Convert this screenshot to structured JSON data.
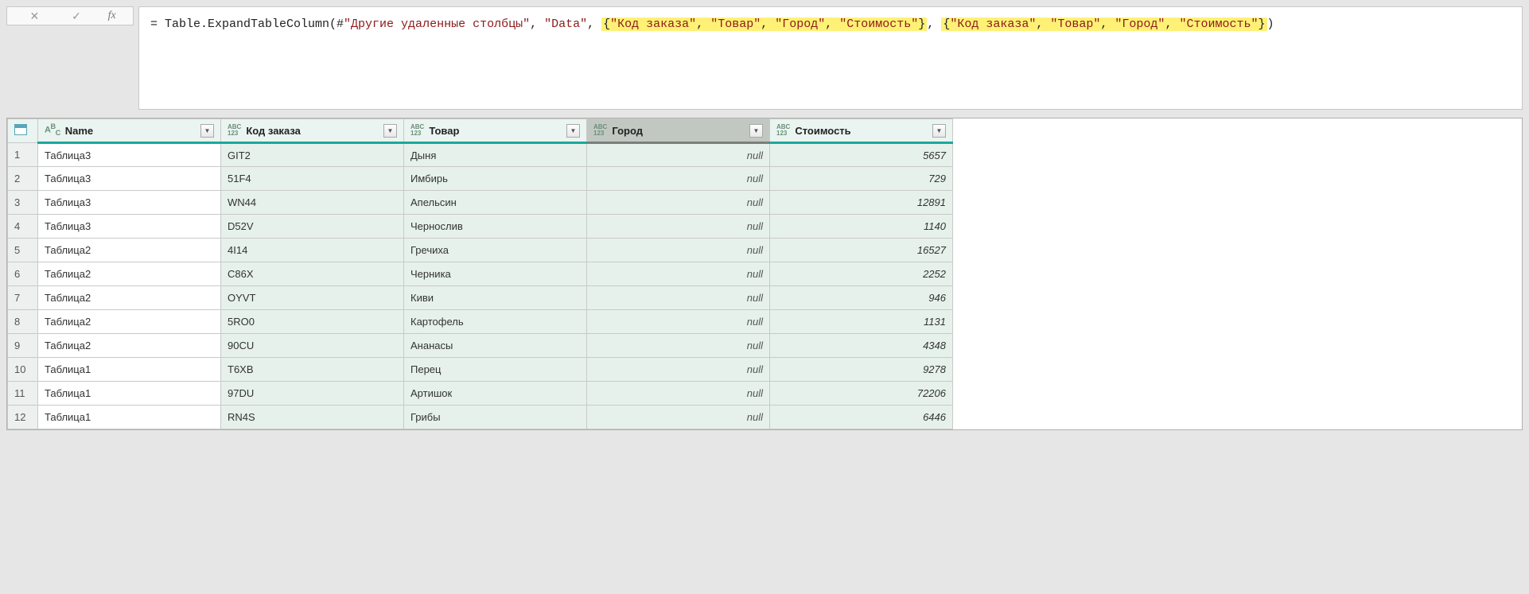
{
  "formula": {
    "prefix": "= Table.ExpandTableColumn(#",
    "step_name": "\"Другие удаленные столбцы\"",
    "sep1": ", ",
    "data_arg": "\"Data\"",
    "sep2": ", ",
    "list1_open": "{",
    "list1_items": [
      "\"Код заказа\"",
      "\"Товар\"",
      "\"Город\"",
      "\"Стоимость\""
    ],
    "list1_close": "}",
    "sep3": ", ",
    "list2_open": "{",
    "list2_items": [
      "\"Код заказа\"",
      "\"Товар\"",
      "\"Город\"",
      "\"Стоимость\""
    ],
    "list2_close": "}",
    "suffix": ")"
  },
  "columns": {
    "name": "Name",
    "c1": "Код заказа",
    "c2": "Товар",
    "c3": "Город",
    "c4": "Стоимость"
  },
  "null_text": "null",
  "rows": [
    {
      "n": "1",
      "name": "Таблица3",
      "c1": "GIT2",
      "c2": "Дыня",
      "c3": null,
      "c4": "5657"
    },
    {
      "n": "2",
      "name": "Таблица3",
      "c1": "51F4",
      "c2": "Имбирь",
      "c3": null,
      "c4": "729"
    },
    {
      "n": "3",
      "name": "Таблица3",
      "c1": "WN44",
      "c2": "Апельсин",
      "c3": null,
      "c4": "12891"
    },
    {
      "n": "4",
      "name": "Таблица3",
      "c1": "D52V",
      "c2": "Чернослив",
      "c3": null,
      "c4": "1140"
    },
    {
      "n": "5",
      "name": "Таблица2",
      "c1": "4I14",
      "c2": "Гречиха",
      "c3": null,
      "c4": "16527"
    },
    {
      "n": "6",
      "name": "Таблица2",
      "c1": "C86X",
      "c2": "Черника",
      "c3": null,
      "c4": "2252"
    },
    {
      "n": "7",
      "name": "Таблица2",
      "c1": "OYVT",
      "c2": "Киви",
      "c3": null,
      "c4": "946"
    },
    {
      "n": "8",
      "name": "Таблица2",
      "c1": "5RO0",
      "c2": "Картофель",
      "c3": null,
      "c4": "1131"
    },
    {
      "n": "9",
      "name": "Таблица2",
      "c1": "90CU",
      "c2": "Ананасы",
      "c3": null,
      "c4": "4348"
    },
    {
      "n": "10",
      "name": "Таблица1",
      "c1": "T6XB",
      "c2": "Перец",
      "c3": null,
      "c4": "9278"
    },
    {
      "n": "11",
      "name": "Таблица1",
      "c1": "97DU",
      "c2": "Артишок",
      "c3": null,
      "c4": "72206"
    },
    {
      "n": "12",
      "name": "Таблица1",
      "c1": "RN4S",
      "c2": "Грибы",
      "c3": null,
      "c4": "6446"
    }
  ]
}
